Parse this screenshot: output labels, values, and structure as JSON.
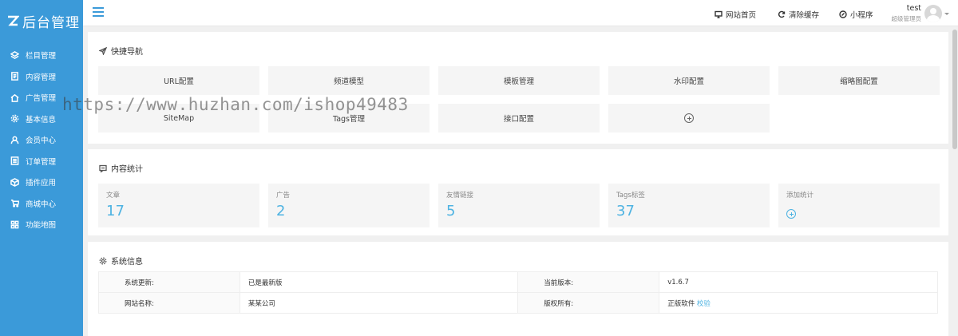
{
  "sidebar": {
    "logo_text": "后台管理",
    "items": [
      {
        "label": "栏目管理",
        "icon": "layers-icon"
      },
      {
        "label": "内容管理",
        "icon": "document-icon"
      },
      {
        "label": "广告管理",
        "icon": "home-icon"
      },
      {
        "label": "基本信息",
        "icon": "gear-icon"
      },
      {
        "label": "会员中心",
        "icon": "user-icon"
      },
      {
        "label": "订单管理",
        "icon": "list-icon"
      },
      {
        "label": "插件应用",
        "icon": "box-icon"
      },
      {
        "label": "商城中心",
        "icon": "cart-icon"
      },
      {
        "label": "功能地图",
        "icon": "grid-icon"
      }
    ]
  },
  "header": {
    "links": [
      "网站首页",
      "清除缓存",
      "小程序"
    ],
    "user_name": "test",
    "user_role": "超级管理员"
  },
  "quick_nav": {
    "title": "快捷导航",
    "items": [
      "URL配置",
      "频道模型",
      "模板管理",
      "水印配置",
      "缩略图配置",
      "SiteMap",
      "Tags管理",
      "接口配置"
    ]
  },
  "stats": {
    "title": "内容统计",
    "items": [
      {
        "label": "文章",
        "value": "17"
      },
      {
        "label": "广告",
        "value": "2"
      },
      {
        "label": "友情链接",
        "value": "5"
      },
      {
        "label": "Tags标签",
        "value": "37"
      }
    ],
    "add_label": "添加统计"
  },
  "system": {
    "title": "系统信息",
    "rows": [
      {
        "k1": "系统更新:",
        "v1": "已是最新版",
        "k2": "当前版本:",
        "v2": "v1.6.7"
      },
      {
        "k1": "网站名称:",
        "v1": "某某公司",
        "k2": "版权所有:",
        "v2": "正版软件",
        "v2_link": "校验"
      }
    ]
  },
  "watermark": "https://www.huzhan.com/ishop49483",
  "colors": {
    "sidebar": "#3b9ad9",
    "accent": "#4eb3e2"
  }
}
